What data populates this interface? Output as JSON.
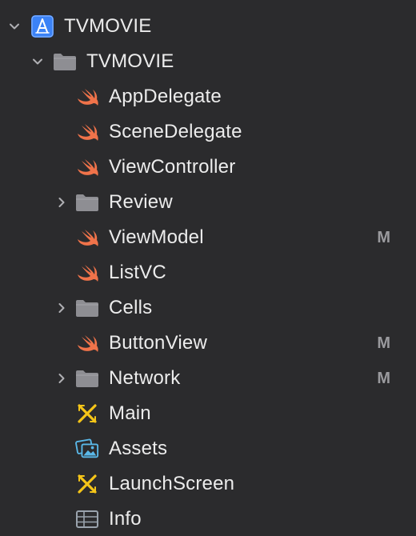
{
  "navigator": {
    "project": {
      "label": "TVMOVIE",
      "icon": "xcode-project-icon",
      "expanded": true
    },
    "group": {
      "label": "TVMOVIE",
      "icon": "folder-icon",
      "expanded": true
    },
    "items": [
      {
        "label": "AppDelegate",
        "icon": "swift-file-icon",
        "badge": ""
      },
      {
        "label": "SceneDelegate",
        "icon": "swift-file-icon",
        "badge": ""
      },
      {
        "label": "ViewController",
        "icon": "swift-file-icon",
        "badge": ""
      },
      {
        "label": "Review",
        "icon": "folder-icon",
        "badge": "",
        "collapsed": true
      },
      {
        "label": "ViewModel",
        "icon": "swift-file-icon",
        "badge": "M"
      },
      {
        "label": "ListVC",
        "icon": "swift-file-icon",
        "badge": ""
      },
      {
        "label": "Cells",
        "icon": "folder-icon",
        "badge": "",
        "collapsed": true
      },
      {
        "label": "ButtonView",
        "icon": "swift-file-icon",
        "badge": "M"
      },
      {
        "label": "Network",
        "icon": "folder-icon",
        "badge": "M",
        "collapsed": true
      },
      {
        "label": "Main",
        "icon": "storyboard-icon",
        "badge": ""
      },
      {
        "label": "Assets",
        "icon": "asset-catalog-icon",
        "badge": ""
      },
      {
        "label": "LaunchScreen",
        "icon": "storyboard-icon",
        "badge": ""
      },
      {
        "label": "Info",
        "icon": "plist-icon",
        "badge": ""
      }
    ]
  },
  "colors": {
    "background": "#2b2b2d",
    "text": "#ececec",
    "badge": "#9a9a9e",
    "swift": "#f0734a",
    "folder": "#8e8e93",
    "project_blue": "#3b82f6",
    "storyboard_yellow": "#f5c518",
    "assets_blue": "#5ab8e8"
  }
}
